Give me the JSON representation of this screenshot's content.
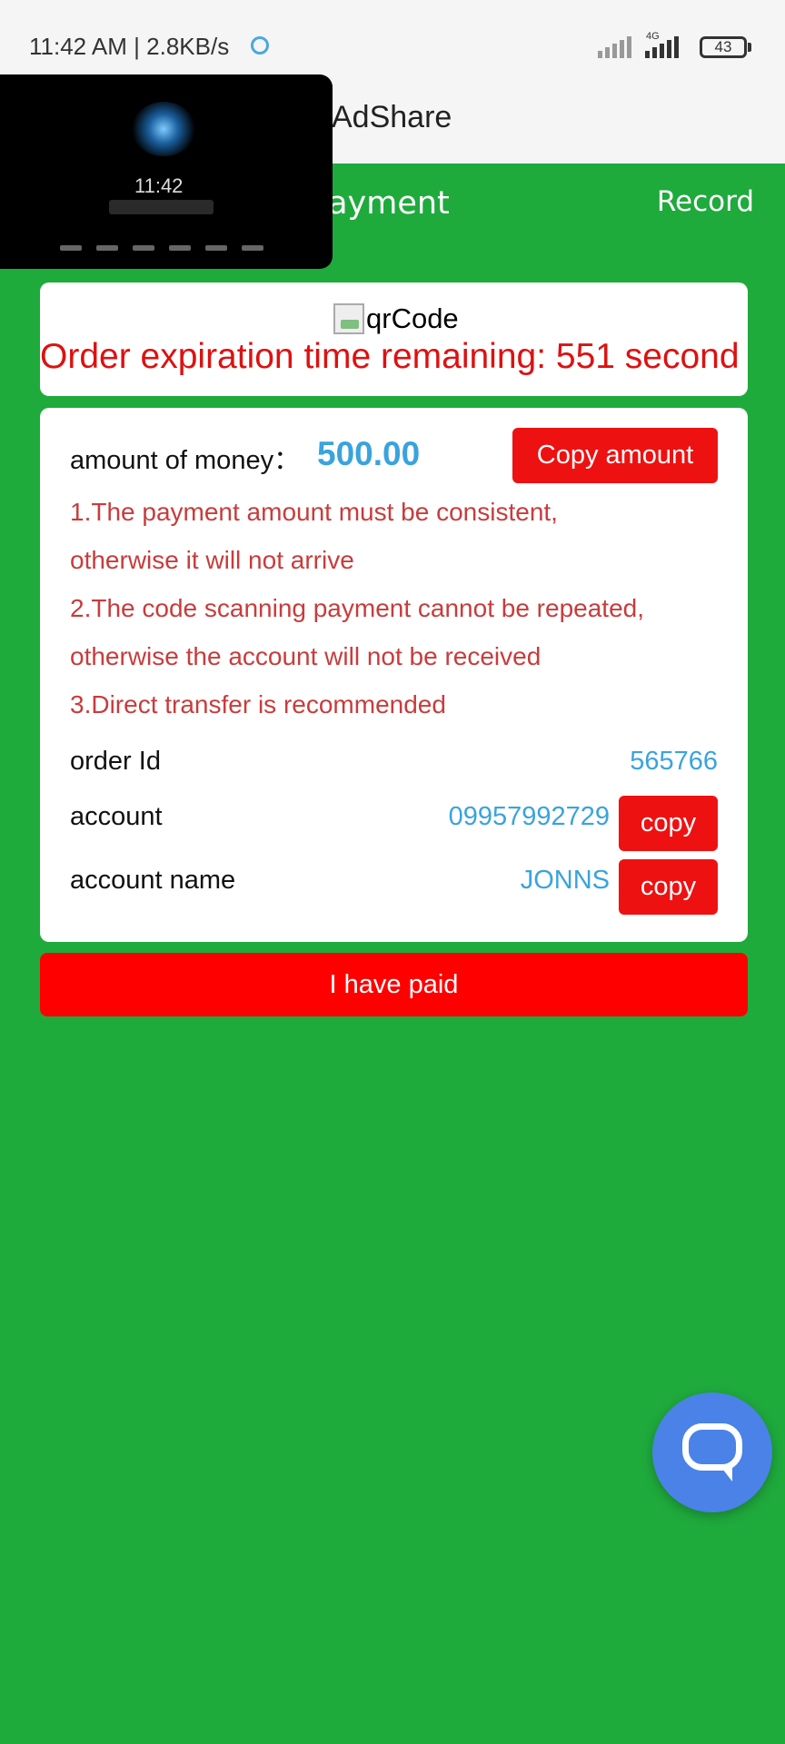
{
  "status_bar": {
    "time": "11:42 AM",
    "network_speed": "2.8KB/s",
    "network_type": "4G",
    "battery": "43"
  },
  "app": {
    "title": "AdShare"
  },
  "header": {
    "title": "sh Payment",
    "record_label": "Record"
  },
  "overlay_thumbnail": {
    "time": "11:42"
  },
  "qr_card": {
    "image_alt": "qrCode",
    "expiration_text": "Order expiration time remaining: 551 second"
  },
  "payment": {
    "amount_label": "amount of money：",
    "amount_value": "500.00",
    "copy_amount_label": "Copy amount",
    "notices": [
      "1.The payment amount must be consistent,",
      "otherwise it will not arrive",
      "2.The code scanning payment cannot be repeated,",
      "otherwise the account will not be received",
      "3.Direct transfer is recommended"
    ],
    "order_id_label": "order Id",
    "order_id_value": "565766",
    "account_label": "account",
    "account_value": "09957992729",
    "account_name_label": "account name",
    "account_name_value": "JONNS",
    "copy_label": "copy"
  },
  "paid_button_label": "I have paid",
  "colors": {
    "background_green": "#1faa3c",
    "accent_red": "#ee1111",
    "value_blue": "#3aa3dd",
    "notice_red": "#c83c3c",
    "chat_blue": "#4a82e8"
  },
  "icons": [
    "data-saver-icon",
    "signal-icon",
    "battery-icon",
    "chat-icon",
    "broken-image-icon"
  ]
}
